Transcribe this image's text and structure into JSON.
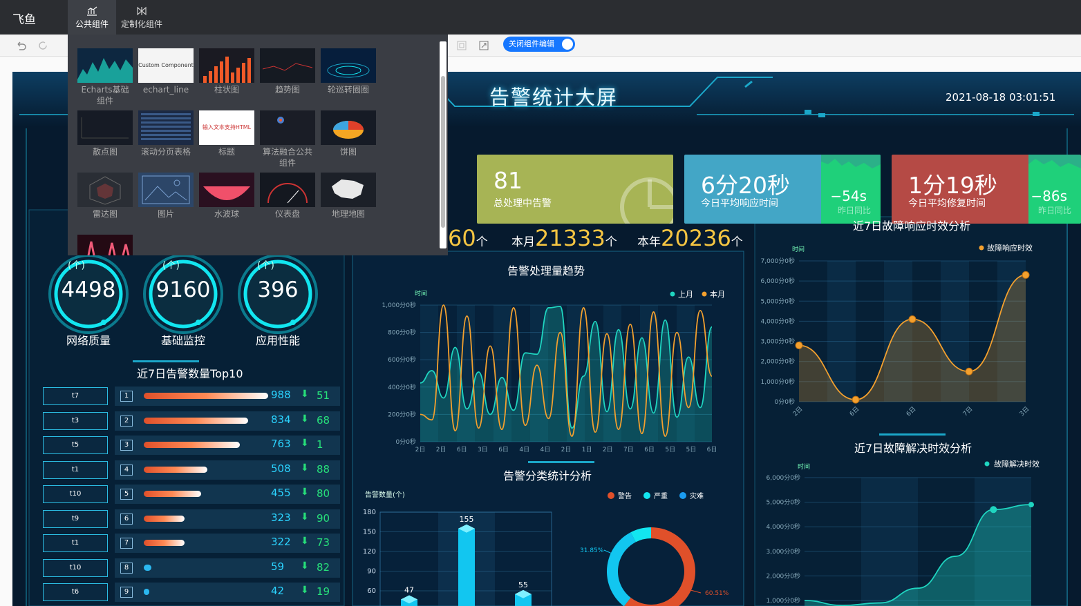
{
  "app": {
    "logo": "飞鱼",
    "tabs": [
      {
        "label": "公共组件"
      },
      {
        "label": "定制化组件"
      }
    ],
    "toggle_label": "关闭组件编辑"
  },
  "components": [
    {
      "label": "Echarts基础组件"
    },
    {
      "label": "echart_line"
    },
    {
      "label": "柱状图"
    },
    {
      "label": "趋势图"
    },
    {
      "label": "轮巡转圈圈"
    },
    {
      "label": "散点图"
    },
    {
      "label": "滚动分页表格"
    },
    {
      "label": "标题"
    },
    {
      "label": "算法融合公共组件"
    },
    {
      "label": "饼图"
    },
    {
      "label": "雷达图"
    },
    {
      "label": "图片"
    },
    {
      "label": "水波球"
    },
    {
      "label": "仪表盘"
    },
    {
      "label": "地理地图"
    }
  ],
  "thumb_texts": {
    "custom": "Custom Component",
    "title_html": "输入文本支持HTML"
  },
  "dashboard": {
    "title": "告警统计大屏",
    "datetime": "2021-08-18 03:01:51",
    "cards": [
      {
        "value": "81",
        "label": "总处理中告警",
        "color": "#a7b455"
      },
      {
        "value": "6分20秒",
        "label": "今日平均响应时间",
        "diff": "−54s",
        "sub": "昨日同比",
        "color": "#43a6c6"
      },
      {
        "value": "1分19秒",
        "label": "今日平均修复时间",
        "diff": "−86s",
        "sub": "昨日同比",
        "color": "#b54a45"
      }
    ],
    "counts": {
      "today_tail": "60",
      "today_unit": "个",
      "month_prefix": "本月",
      "month_value": "21333",
      "month_unit": "个",
      "year_prefix": "本年",
      "year_value": "20236",
      "year_unit": "个"
    },
    "gauges": [
      {
        "unit": "(个)",
        "value": "4498",
        "label": "网络质量"
      },
      {
        "unit": "(个)",
        "value": "9160",
        "label": "基础监控"
      },
      {
        "unit": "(个)",
        "value": "396",
        "label": "应用性能"
      }
    ],
    "top10_title": "近7日告警数量Top10",
    "top10": [
      {
        "name": "t7",
        "rank": "1",
        "value": "988",
        "delta": "51",
        "fill": 1.0
      },
      {
        "name": "t3",
        "rank": "2",
        "value": "834",
        "delta": "68",
        "fill": 0.84
      },
      {
        "name": "t5",
        "rank": "3",
        "value": "763",
        "delta": "1",
        "fill": 0.77
      },
      {
        "name": "t1",
        "rank": "4",
        "value": "508",
        "delta": "88",
        "fill": 0.51
      },
      {
        "name": "t10",
        "rank": "5",
        "value": "455",
        "delta": "80",
        "fill": 0.46
      },
      {
        "name": "t9",
        "rank": "6",
        "value": "323",
        "delta": "90",
        "fill": 0.33
      },
      {
        "name": "t1",
        "rank": "7",
        "value": "322",
        "delta": "73",
        "fill": 0.33
      },
      {
        "name": "t10",
        "rank": "8",
        "value": "59",
        "delta": "82",
        "fill": 0.06
      },
      {
        "name": "t6",
        "rank": "9",
        "value": "42",
        "delta": "19",
        "fill": 0.04
      }
    ],
    "arrow": "⬇"
  },
  "chart_data": [
    {
      "type": "line",
      "title": "告警处理量趋势",
      "ylabel": "时间",
      "y_ticks": [
        "0分0秒",
        "200分0秒",
        "400分0秒",
        "600分0秒",
        "800分0秒",
        "1,000分0秒"
      ],
      "categories": [
        "2日",
        "2日",
        "6日",
        "3日",
        "6日",
        "4日",
        "4日",
        "2日",
        "1日",
        "2日",
        "7日",
        "6日",
        "5日",
        "5日",
        "6日"
      ],
      "series": [
        {
          "name": "上月",
          "color": "#1fd5c0",
          "values": [
            430,
            520,
            320,
            690,
            240,
            510,
            200,
            470,
            230,
            650,
            640,
            980,
            990,
            100,
            480,
            880,
            220,
            820,
            240,
            760,
            210,
            890,
            180,
            620,
            250,
            840
          ]
        },
        {
          "name": "本月",
          "color": "#f3a02e",
          "values": [
            200,
            160,
            1000,
            80,
            920,
            100,
            700,
            90,
            980,
            120,
            560,
            170,
            800,
            40,
            980,
            70,
            790,
            90,
            860,
            60,
            950,
            40,
            800,
            250,
            960,
            480
          ]
        }
      ]
    },
    {
      "type": "line",
      "title": "近7日故障响应时效分析",
      "ylabel": "时间",
      "y_ticks": [
        "0分0秒",
        "1,000分0秒",
        "2,000分0秒",
        "3,000分0秒",
        "4,000分0秒",
        "5,000分0秒",
        "6,000分0秒",
        "7,000分0秒"
      ],
      "categories": [
        "2日",
        "6日",
        "6日",
        "7日",
        "3日"
      ],
      "series": [
        {
          "name": "故障响应时效",
          "color": "#f3a02e",
          "values": [
            2800,
            100,
            4100,
            1500,
            6300
          ]
        }
      ]
    },
    {
      "type": "area",
      "title": "近7日故障解决时效分析",
      "ylabel": "时间",
      "y_ticks": [
        "1,000分0秒",
        "2,000分0秒",
        "3,000分0秒",
        "4,000分0秒",
        "5,000分0秒",
        "6,000分0秒"
      ],
      "series": [
        {
          "name": "故障解决时效",
          "color": "#1fd5c0",
          "values": [
            1000,
            800,
            900,
            1500,
            2800,
            4700,
            4900
          ]
        }
      ]
    },
    {
      "type": "bar",
      "title": "告警分类统计分析",
      "ylabel": "告警数量(个)",
      "y_ticks": [
        "60",
        "90",
        "120",
        "150",
        "180"
      ],
      "categories": [
        "",
        "",
        ""
      ],
      "values": [
        47,
        155,
        55
      ]
    },
    {
      "type": "pie",
      "legend": [
        "警告",
        "严重",
        "灾难"
      ],
      "legend_colors": [
        "#e0502a",
        "#12e6f0",
        "#1a9cf0"
      ],
      "slices": [
        {
          "name": "严重",
          "value": 60.51,
          "label": "60.51%"
        },
        {
          "name": "灾难",
          "value": 31.85,
          "label": "31.85%"
        },
        {
          "name": "警告",
          "value": 7.64,
          "label": ""
        }
      ]
    }
  ]
}
